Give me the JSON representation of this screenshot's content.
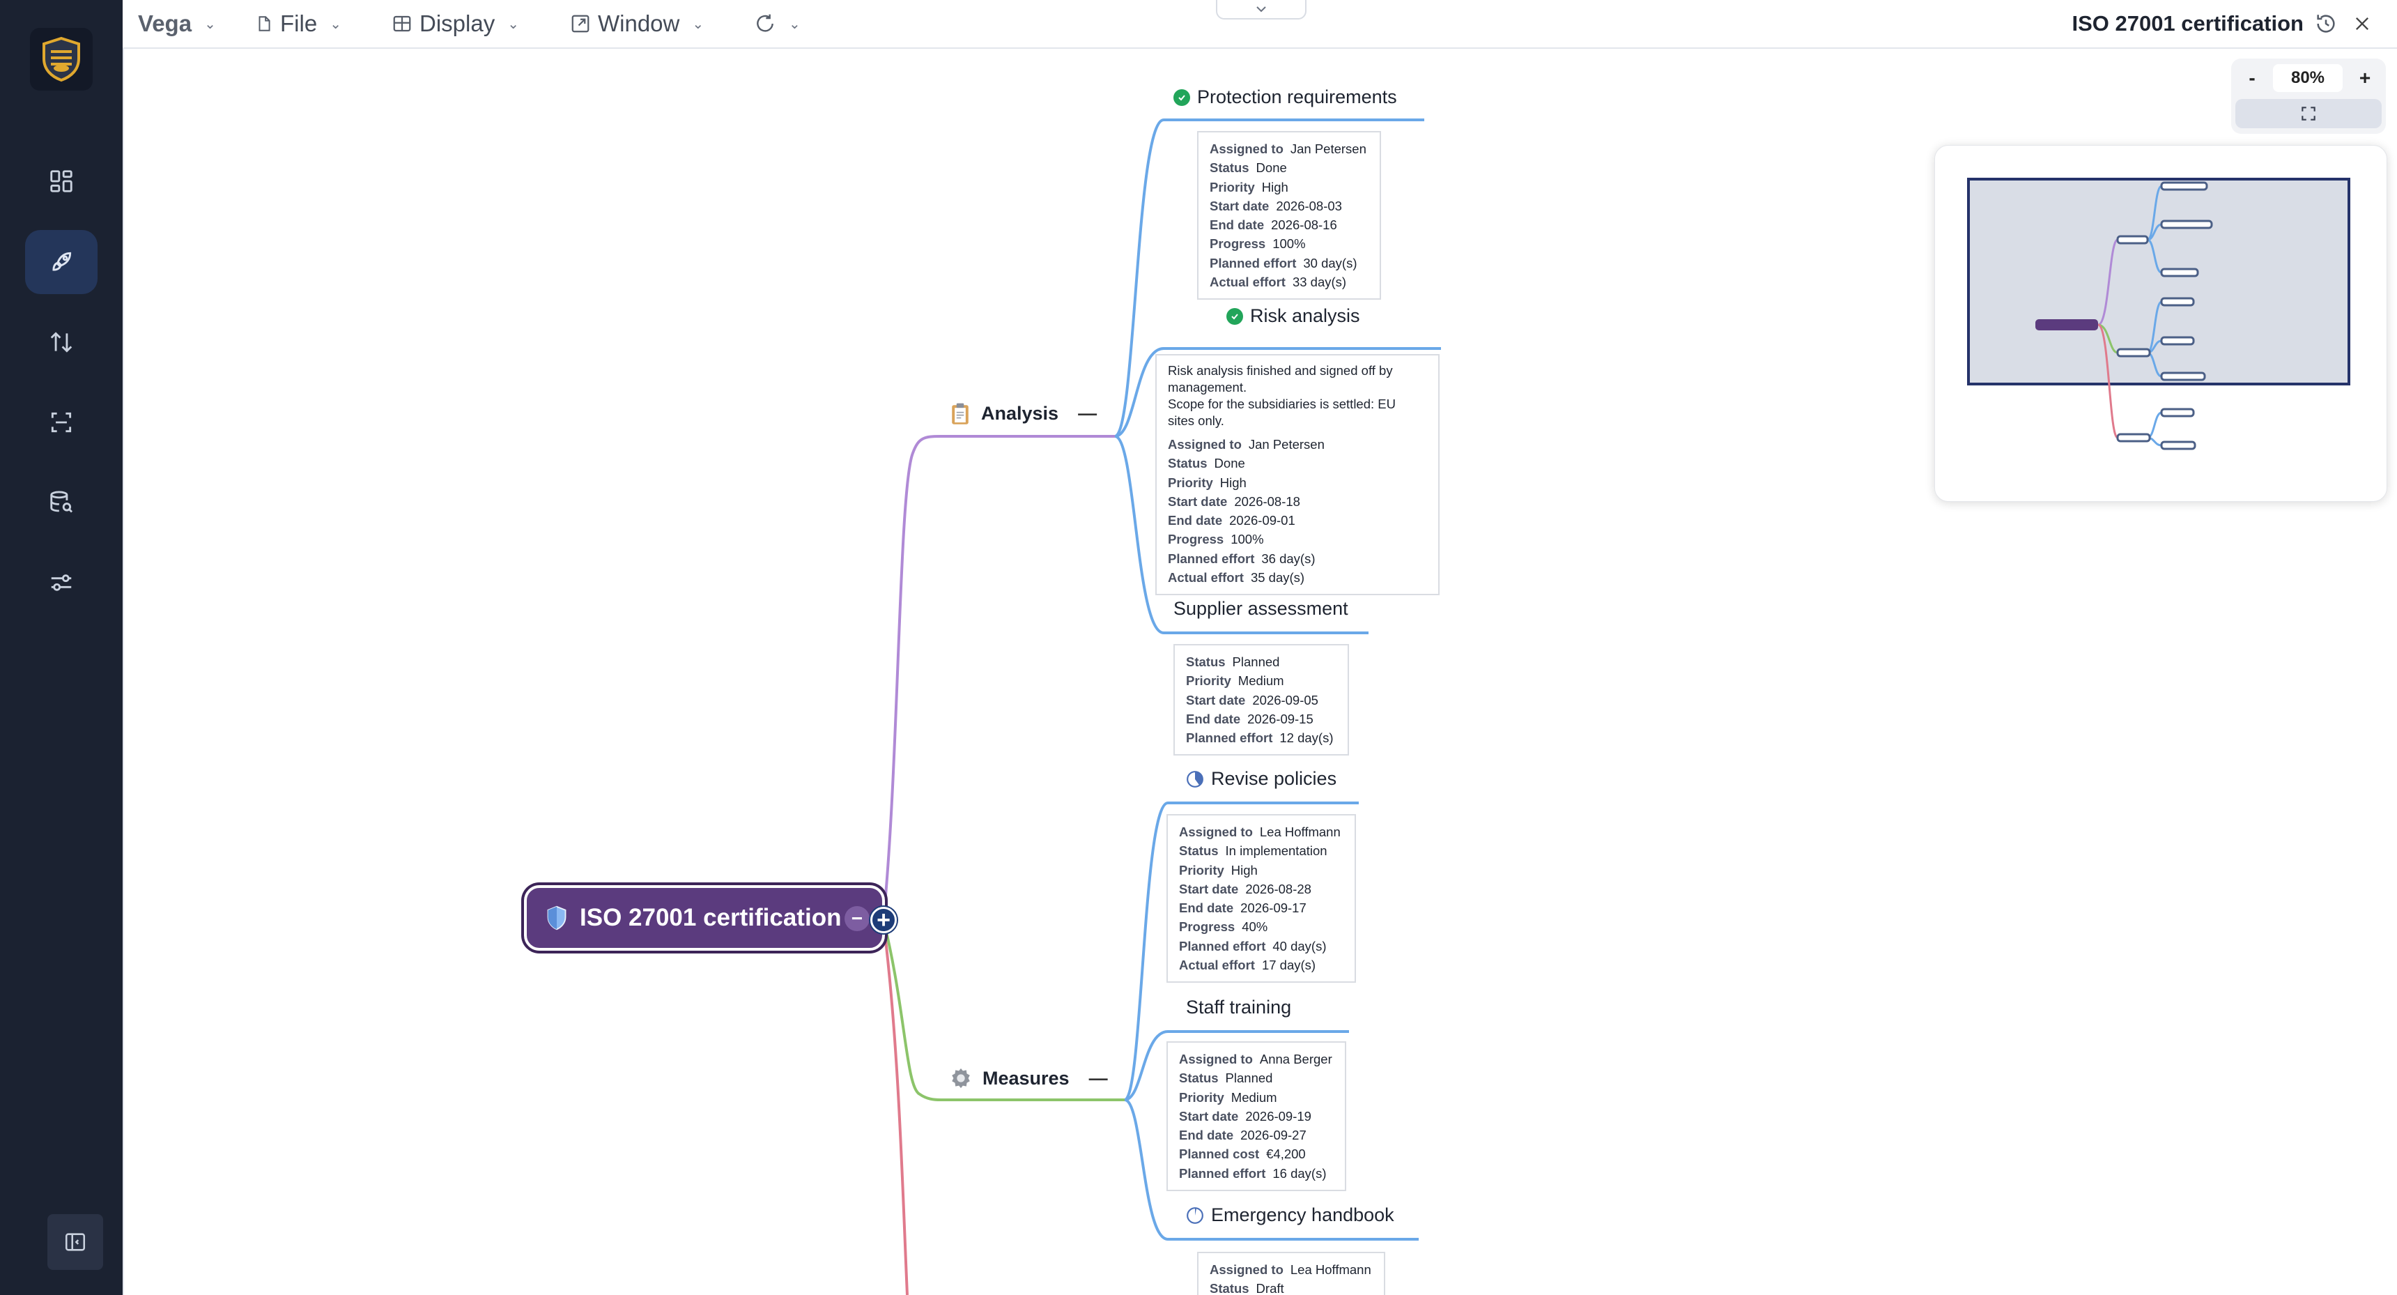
{
  "app": {
    "brand": "Vega",
    "menus": [
      {
        "label": "File",
        "icon": "file-icon"
      },
      {
        "label": "Display",
        "icon": "table-icon"
      },
      {
        "label": "Window",
        "icon": "window-icon"
      }
    ],
    "document_title": "ISO 27001 certification"
  },
  "sidebar": {
    "items": [
      {
        "icon": "dashboard-icon",
        "active": false
      },
      {
        "icon": "rocket-icon",
        "active": true
      },
      {
        "icon": "sort-arrows-icon",
        "active": false
      },
      {
        "icon": "scan-icon",
        "active": false
      },
      {
        "icon": "database-search-icon",
        "active": false
      },
      {
        "icon": "sliders-icon",
        "active": false
      }
    ]
  },
  "zoom": {
    "minus": "-",
    "value": "80%",
    "plus": "+"
  },
  "mindmap": {
    "root": {
      "label": "ISO 27001 certification",
      "icon": "shield-icon"
    },
    "branches": {
      "analysis": {
        "label": "Analysis",
        "icon": "clipboard-icon",
        "toggle": "—"
      },
      "measures": {
        "label": "Measures",
        "icon": "gear-icon",
        "toggle": "—"
      }
    },
    "tasks": {
      "protection": {
        "title": "Protection requirements",
        "status_icon": "check-circle-icon",
        "fields": [
          [
            "Assigned to",
            "Jan Petersen"
          ],
          [
            "Status",
            "Done"
          ],
          [
            "Priority",
            "High"
          ],
          [
            "Start date",
            "2026-08-03"
          ],
          [
            "End date",
            "2026-08-16"
          ],
          [
            "Progress",
            "100%"
          ],
          [
            "Planned effort",
            "30 day(s)"
          ],
          [
            "Actual effort",
            "33 day(s)"
          ]
        ]
      },
      "risk": {
        "title": "Risk analysis",
        "status_icon": "check-circle-icon",
        "note": "Risk analysis finished and signed off by\nmanagement.\nScope for the subsidiaries is settled: EU\nsites only.",
        "fields": [
          [
            "Assigned to",
            "Jan Petersen"
          ],
          [
            "Status",
            "Done"
          ],
          [
            "Priority",
            "High"
          ],
          [
            "Start date",
            "2026-08-18"
          ],
          [
            "End date",
            "2026-09-01"
          ],
          [
            "Progress",
            "100%"
          ],
          [
            "Planned effort",
            "36 day(s)"
          ],
          [
            "Actual effort",
            "35 day(s)"
          ]
        ]
      },
      "supplier": {
        "title": "Supplier assessment",
        "fields": [
          [
            "Status",
            "Planned"
          ],
          [
            "Priority",
            "Medium"
          ],
          [
            "Start date",
            "2026-09-05"
          ],
          [
            "End date",
            "2026-09-15"
          ],
          [
            "Planned effort",
            "12 day(s)"
          ]
        ]
      },
      "policies": {
        "title": "Revise policies",
        "status_icon": "progress-pie-icon",
        "progress": 0.4,
        "fields": [
          [
            "Assigned to",
            "Lea Hoffmann"
          ],
          [
            "Status",
            "In implementation"
          ],
          [
            "Priority",
            "High"
          ],
          [
            "Start date",
            "2026-08-28"
          ],
          [
            "End date",
            "2026-09-17"
          ],
          [
            "Progress",
            "40%"
          ],
          [
            "Planned effort",
            "40 day(s)"
          ],
          [
            "Actual effort",
            "17 day(s)"
          ]
        ]
      },
      "training": {
        "title": "Staff training",
        "fields": [
          [
            "Assigned to",
            "Anna Berger"
          ],
          [
            "Status",
            "Planned"
          ],
          [
            "Priority",
            "Medium"
          ],
          [
            "Start date",
            "2026-09-19"
          ],
          [
            "End date",
            "2026-09-27"
          ],
          [
            "Planned cost",
            "€4,200"
          ],
          [
            "Planned effort",
            "16 day(s)"
          ]
        ]
      },
      "handbook": {
        "title": "Emergency handbook",
        "status_icon": "progress-pie-icon",
        "fields": [
          [
            "Assigned to",
            "Lea Hoffmann"
          ],
          [
            "Status",
            "Draft"
          ]
        ]
      }
    }
  },
  "colors": {
    "sidebar_bg": "#1b2231",
    "root_fill": "#5b3b7e",
    "analysis_line": "#b08ad6",
    "measures_line": "#8cc46a",
    "third_line": "#e07a8c",
    "task_line": "#6aa8e8",
    "done_green": "#22a55a"
  }
}
